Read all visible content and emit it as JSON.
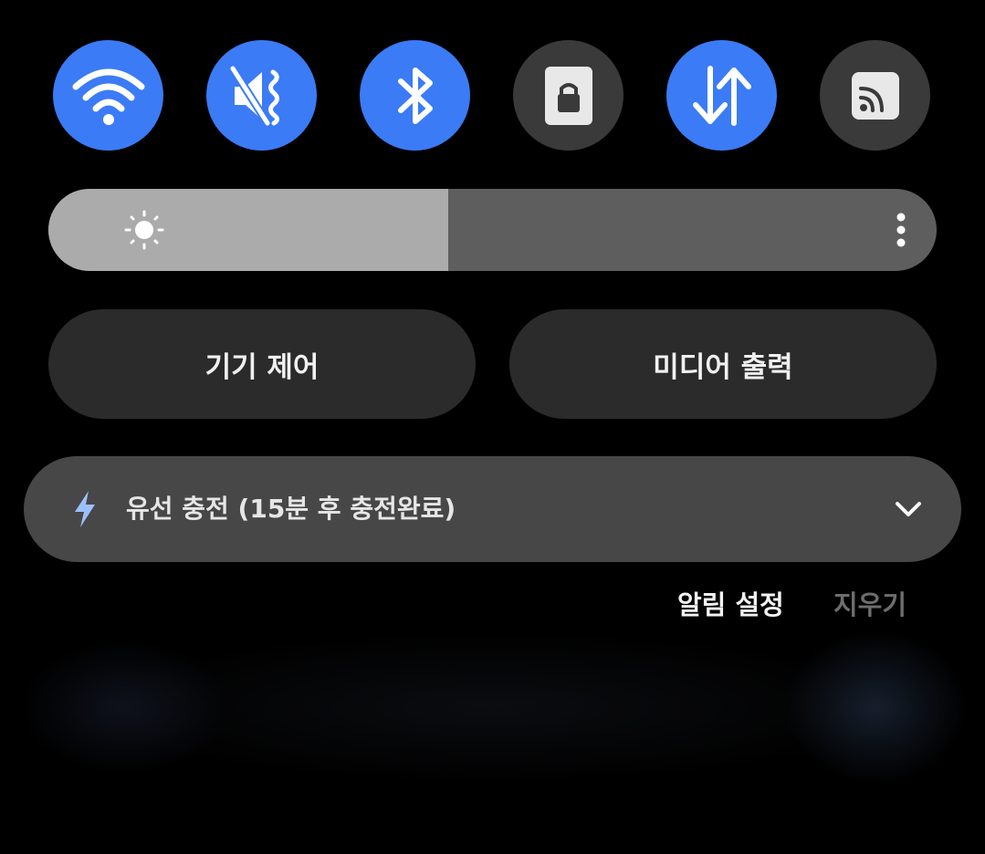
{
  "quick_toggles": [
    {
      "name": "wifi",
      "icon": "wifi-icon",
      "state": "on"
    },
    {
      "name": "sound",
      "icon": "vibrate-mute-icon",
      "state": "on"
    },
    {
      "name": "bluetooth",
      "icon": "bluetooth-icon",
      "state": "on"
    },
    {
      "name": "screen_lock",
      "icon": "lock-icon",
      "state": "off"
    },
    {
      "name": "mobile_data",
      "icon": "data-transfer-icon",
      "state": "on"
    },
    {
      "name": "cast",
      "icon": "cast-icon",
      "state": "off"
    }
  ],
  "brightness": {
    "level_percent": 45,
    "icon": "sun-icon",
    "more_icon": "more-vertical-icon"
  },
  "panel_buttons": {
    "device_control": "기기 제어",
    "media_output": "미디어 출력"
  },
  "notification": {
    "icon": "charging-bolt-icon",
    "text": "유선 충전 (15분 후 충전완료)",
    "expand_icon": "chevron-down-icon"
  },
  "actions": {
    "notification_settings": "알림 설정",
    "clear": "지우기"
  },
  "colors": {
    "accent_on": "#3b7bf6",
    "toggle_off": "#3a3a3a",
    "background": "#000000",
    "card": "#474747",
    "pill": "#2b2b2b"
  }
}
